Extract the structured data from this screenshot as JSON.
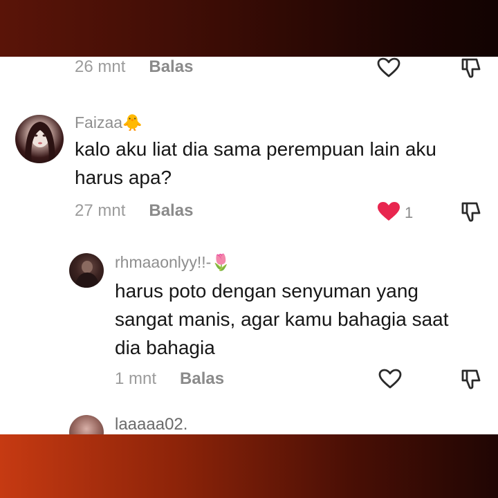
{
  "comments": [
    {
      "time": "26 mnt",
      "reply_label": "Balas"
    },
    {
      "username": "Faizaa",
      "username_emoji": "🐥",
      "text_line1": "kalo aku liat dia sama perempuan lain aku",
      "text_line2": "harus apa?",
      "time": "27 mnt",
      "reply_label": "Balas",
      "likes": "1",
      "liked": true
    },
    {
      "username": "rhmaaonlyy!!-",
      "username_emoji": "🌷",
      "text_line1": "harus poto dengan senyuman yang",
      "text_line2": "sangat manis, agar kamu bahagia saat",
      "text_line3": "dia bahagia",
      "time": "1 mnt",
      "reply_label": "Balas"
    },
    {
      "username": "laaaaa02."
    }
  ],
  "colors": {
    "liked_heart": "#e8264f",
    "panel_background": "#ffffff"
  }
}
